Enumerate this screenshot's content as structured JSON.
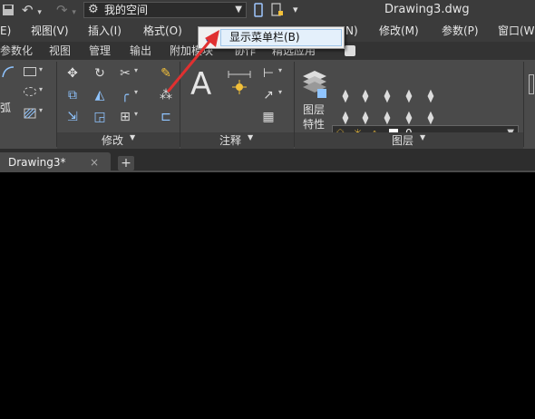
{
  "title_bar": {
    "workspace": "我的空间",
    "document_title": "Drawing3.dwg"
  },
  "menus": [
    {
      "label": "E)"
    },
    {
      "label": "视图(V)"
    },
    {
      "label": "插入(I)"
    },
    {
      "label": "格式(O)"
    },
    {
      "label": "N)"
    },
    {
      "label": "修改(M)"
    },
    {
      "label": "参数(P)"
    },
    {
      "label": "窗口(W"
    }
  ],
  "context_menu": {
    "item_label": "显示菜单栏(B)",
    "checked": true
  },
  "ribbon_tabs": [
    {
      "label": "参数化"
    },
    {
      "label": "视图"
    },
    {
      "label": "管理"
    },
    {
      "label": "输出"
    },
    {
      "label": "附加模块"
    },
    {
      "label": "协作"
    },
    {
      "label": "精选应用"
    }
  ],
  "ribbon": {
    "arc_label": "弧",
    "panels": {
      "modify": "修改",
      "annotate": "注释",
      "layers": "图层"
    },
    "layer_properties": {
      "line1": "图层",
      "line2": "特性"
    },
    "layer_current": "0",
    "text_glyph": "A"
  },
  "document_tab": {
    "label": "Drawing3*",
    "close": "×",
    "new_tab": "+"
  },
  "colors": {
    "annotation_arrow": "#e03030",
    "check": "#1f3f9f",
    "ribbon_bg": "#4a4a4a",
    "titlebar_bg": "#3b3b3b"
  }
}
